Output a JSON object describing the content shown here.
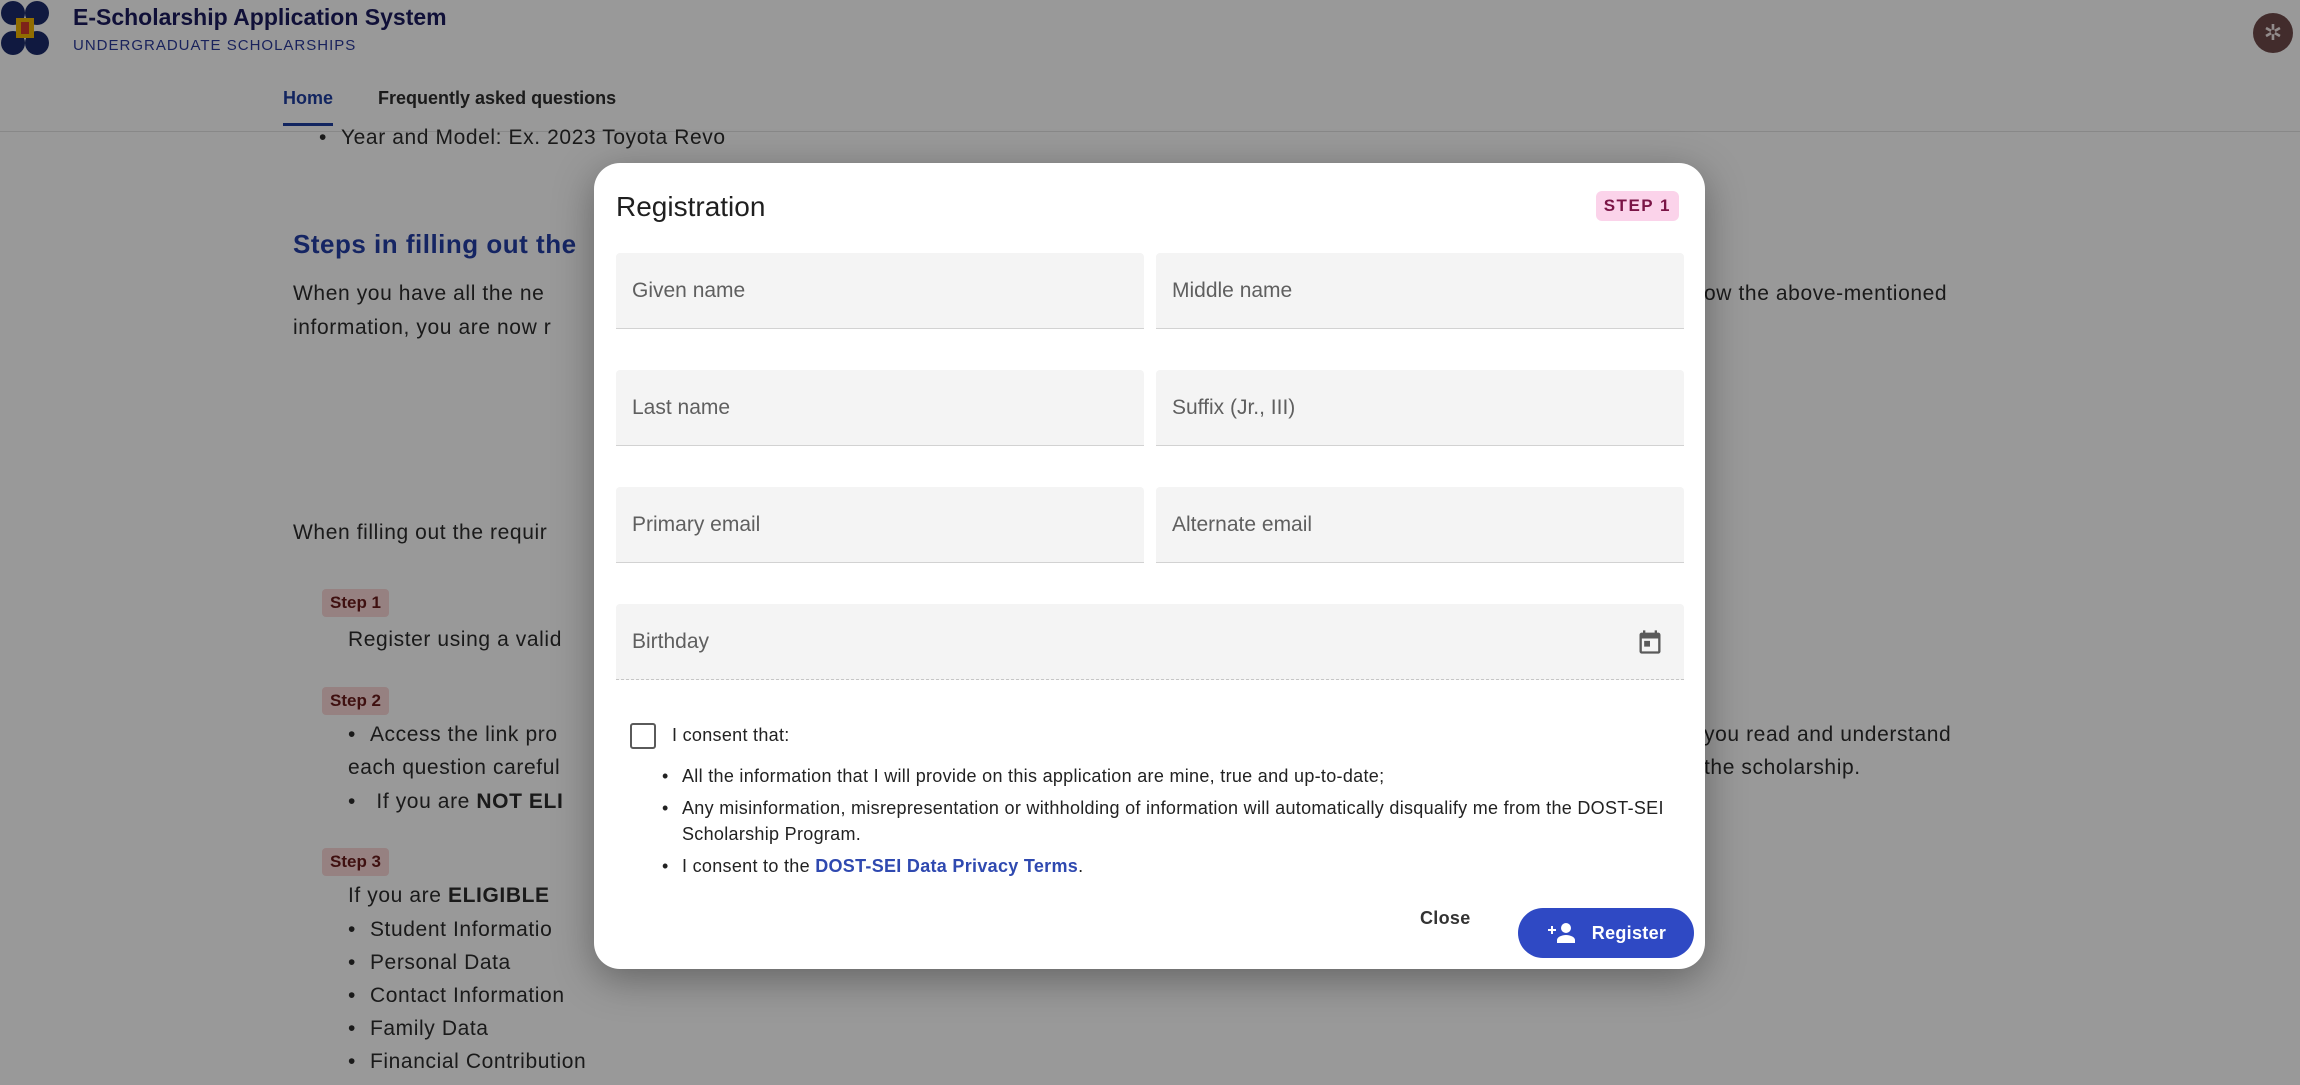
{
  "app": {
    "title": "E-Scholarship Application System",
    "subtitle": "UNDERGRADUATE SCHOLARSHIPS",
    "settings_icon": "gear-icon"
  },
  "nav": {
    "items": [
      {
        "label": "Home",
        "active": true
      },
      {
        "label": "Frequently asked questions",
        "active": false
      }
    ]
  },
  "background": {
    "year_model": "Year and Model: Ex. 2023 Toyota Revo",
    "steps_heading": "Steps in filling out the",
    "para1_left": "When you have all the ne",
    "para1_right": "ow the above-mentioned",
    "para1_line2": "information, you are now r",
    "filling_out": "When filling out the requir",
    "step1_chip": "Step 1",
    "step1_text": "Register using a valid",
    "step2_chip": "Step 2",
    "step2_line1_left": "Access the link pro",
    "step2_line1_right": "you read and understand",
    "step2_line2_left": "each question careful",
    "step2_line2_right": "the scholarship.",
    "step2_line3_prefix": "If you are ",
    "step2_line3_bold": "NOT ELI",
    "step3_chip": "Step 3",
    "step3_prefix": "If you are ",
    "step3_bold": "ELIGIBLE",
    "step3_items": [
      "Student Informatio",
      "Personal Data",
      "Contact Information",
      "Family Data",
      "Financial Contribution"
    ]
  },
  "modal": {
    "title": "Registration",
    "step_badge": "STEP 1",
    "fields": {
      "given_name": {
        "placeholder": "Given name",
        "value": ""
      },
      "middle_name": {
        "placeholder": "Middle name",
        "value": ""
      },
      "last_name": {
        "placeholder": "Last name",
        "value": ""
      },
      "suffix": {
        "placeholder": "Suffix (Jr., III)",
        "value": ""
      },
      "primary_email": {
        "placeholder": "Primary email",
        "value": ""
      },
      "alternate_email": {
        "placeholder": "Alternate email",
        "value": ""
      },
      "birthday": {
        "placeholder": "Birthday",
        "value": "",
        "icon": "calendar-icon"
      }
    },
    "consent": {
      "label": "I consent that:",
      "checked": false,
      "items": [
        "All the information that I will provide on this application are mine, true and up-to-date;",
        "Any misinformation, misrepresentation or withholding of information will automatically disqualify me from the DOST-SEI Scholarship Program."
      ],
      "privacy_prefix": "I consent to the ",
      "privacy_link": "DOST-SEI Data Privacy Terms",
      "privacy_suffix": "."
    },
    "buttons": {
      "close": "Close",
      "register": "Register",
      "register_icon": "person-add-icon"
    }
  },
  "colors": {
    "accent": "#2f49c4",
    "heading_blue": "#243fa5",
    "step_badge_bg": "#fbd3ea",
    "step_chip_bg": "#fbd7d7",
    "settings_bg": "#6f4a4a"
  }
}
